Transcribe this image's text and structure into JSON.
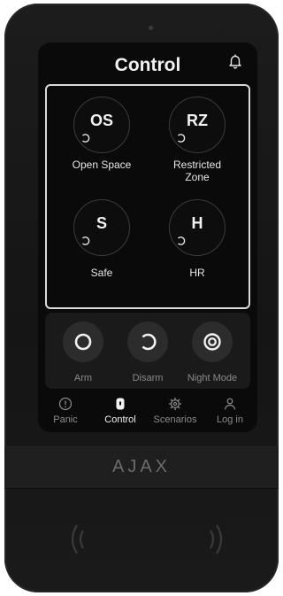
{
  "header": {
    "title": "Control",
    "bell_icon": "bell-icon"
  },
  "zones": [
    {
      "abbr": "OS",
      "name": "Open Space",
      "status_icon": "partial-circle-icon"
    },
    {
      "abbr": "RZ",
      "name": "Restricted Zone",
      "status_icon": "partial-circle-icon"
    },
    {
      "abbr": "S",
      "name": "Safe",
      "status_icon": "partial-circle-icon"
    },
    {
      "abbr": "H",
      "name": "HR",
      "status_icon": "partial-circle-icon"
    }
  ],
  "modes": [
    {
      "label": "Arm",
      "icon": "ring-icon"
    },
    {
      "label": "Disarm",
      "icon": "open-ring-icon"
    },
    {
      "label": "Night Mode",
      "icon": "night-ring-icon"
    }
  ],
  "nav": [
    {
      "label": "Panic",
      "icon": "alert-circle-icon",
      "active": false
    },
    {
      "label": "Control",
      "icon": "shield-lock-icon",
      "active": true
    },
    {
      "label": "Scenarios",
      "icon": "gear-icon",
      "active": false
    },
    {
      "label": "Log in",
      "icon": "user-icon",
      "active": false
    }
  ],
  "device": {
    "brand": "AJAX"
  },
  "colors": {
    "background": "#0a0a0a",
    "device": "#1a1a1a",
    "text": "#f0f0f0",
    "muted": "#8a8a8a",
    "frame": "#d9d9d9"
  }
}
